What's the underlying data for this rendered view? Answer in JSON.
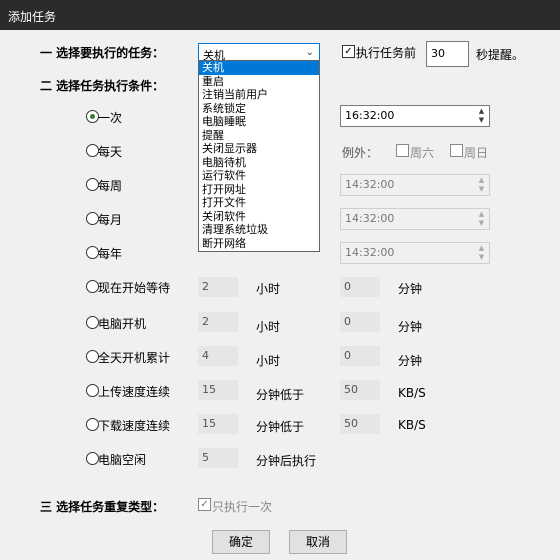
{
  "window": {
    "title": "添加任务"
  },
  "section1": {
    "label": "一 选择要执行的任务："
  },
  "task_select": {
    "value": "关机",
    "options": [
      "关机",
      "重启",
      "注销当前用户",
      "系统锁定",
      "电脑睡眠",
      "提醒",
      "关闭显示器",
      "电脑待机",
      "运行软件",
      "打开网址",
      "打开文件",
      "关闭软件",
      "清理系统垃圾",
      "断开网络"
    ]
  },
  "before_exec": {
    "checked": true,
    "label": "执行任务前",
    "seconds": "30",
    "suffix": "秒提醒。"
  },
  "section2": {
    "label": "二 选择任务执行条件："
  },
  "conditions": {
    "once": {
      "label": "一次",
      "selected": true,
      "time": "16:32:00"
    },
    "daily": {
      "label": "每天",
      "except_label": "例外：",
      "sat": "周六",
      "sun": "周日"
    },
    "weekly": {
      "label": "每周",
      "time": "14:32:00"
    },
    "monthly": {
      "label": "每月",
      "time": "14:32:00"
    },
    "yearly": {
      "label": "每年",
      "time": "14:32:00"
    },
    "wait": {
      "label": "现在开始等待",
      "hours": "2",
      "hours_unit": "小时",
      "minutes": "0",
      "minutes_unit": "分钟"
    },
    "boot": {
      "label": "电脑开机",
      "hours": "2",
      "hours_unit": "小时",
      "minutes": "0",
      "minutes_unit": "分钟"
    },
    "all_day": {
      "label": "全天开机累计",
      "hours": "4",
      "hours_unit": "小时",
      "minutes": "0",
      "minutes_unit": "分钟"
    },
    "upload": {
      "label": "上传速度连续",
      "minutes": "15",
      "mid": "分钟低于",
      "speed": "50",
      "unit": "KB/S"
    },
    "download": {
      "label": "下载速度连续",
      "minutes": "15",
      "mid": "分钟低于",
      "speed": "50",
      "unit": "KB/S"
    },
    "idle": {
      "label": "电脑空闲",
      "minutes": "5",
      "mid": "分钟后执行"
    }
  },
  "section3": {
    "label": "三 选择任务重复类型：",
    "once_label": "只执行一次"
  },
  "buttons": {
    "ok": "确定",
    "cancel": "取消"
  }
}
